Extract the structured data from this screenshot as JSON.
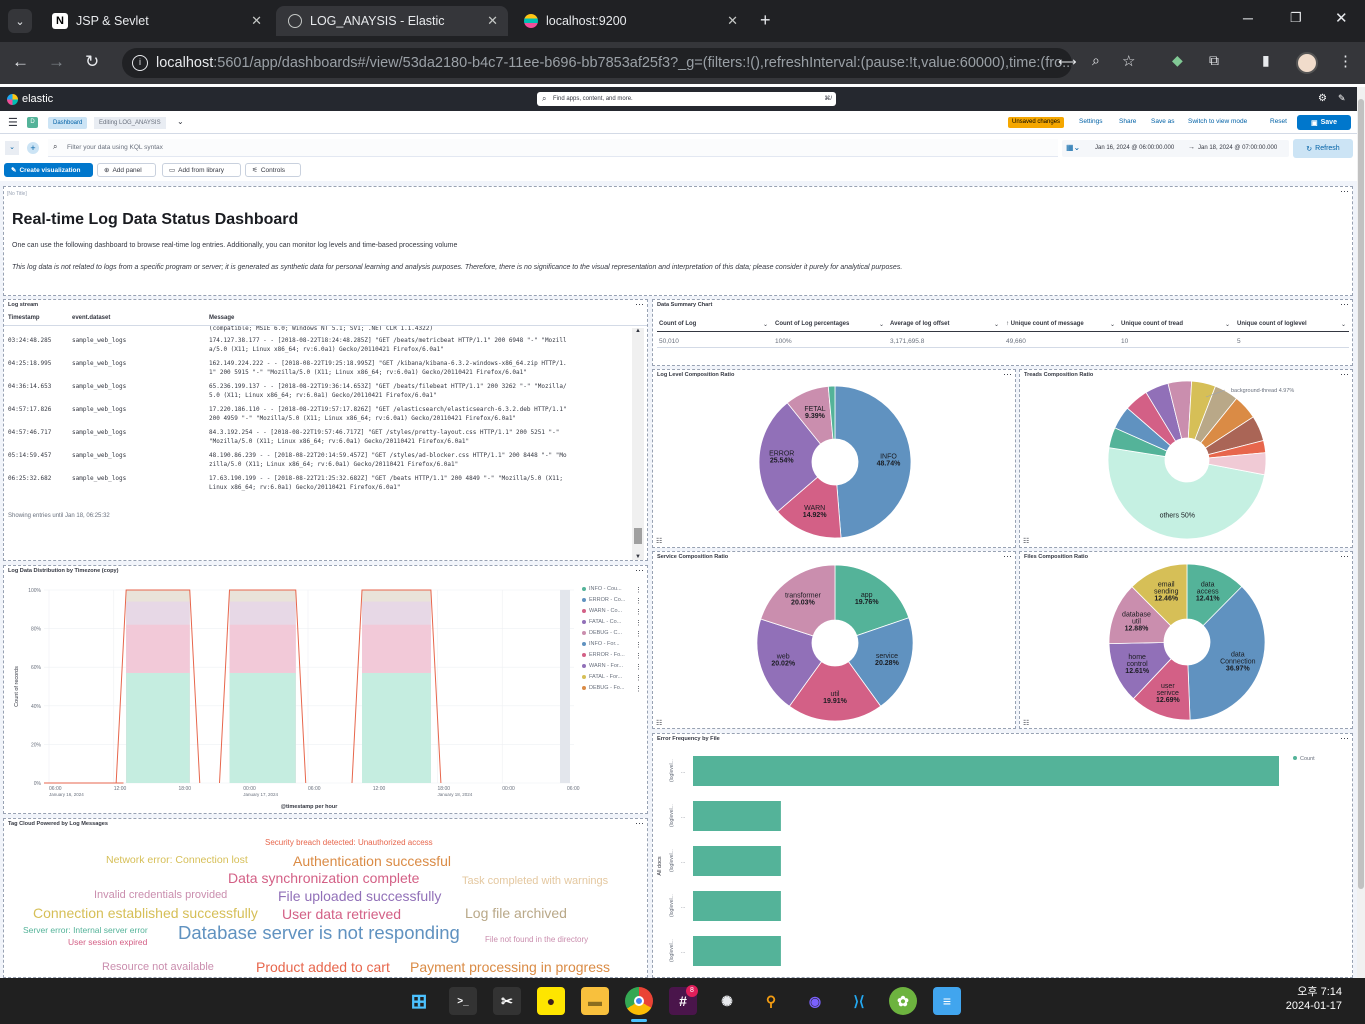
{
  "browser": {
    "tabs": [
      {
        "label": "JSP & Sevlet",
        "icon": "N"
      },
      {
        "label": "LOG_ANAYSIS - Elastic",
        "icon": "elastic"
      },
      {
        "label": "localhost:9200",
        "icon": "elastic"
      }
    ],
    "url_host": "localhost",
    "url_rest": ":5601/app/dashboards#/view/53da2180-b4c7-11ee-b696-bb7853af25f3?_g=(filters:!(),refreshInterval:(pause:!t,value:60000),time:(fro..."
  },
  "kibana": {
    "brand": "elastic",
    "search_placeholder": "Find apps, content, and more.",
    "search_shortcut": "⌘/",
    "space": "D",
    "breadcrumbs": [
      "Dashboard",
      "Editing LOG_ANAYSIS"
    ],
    "unsaved": "Unsaved changes",
    "top_actions": [
      "Settings",
      "Share",
      "Save as",
      "Switch to view mode",
      "Reset"
    ],
    "save": "Save",
    "kql_placeholder": "Filter your data using KQL syntax",
    "time_start": "Jan 16, 2024 @ 06:00:00.000",
    "time_arrow": "→",
    "time_end": "Jan 18, 2024 @ 07:00:00.000",
    "refresh": "Refresh",
    "toolbar": [
      "Create visualization",
      "Add panel",
      "Add from library",
      "Controls"
    ]
  },
  "markdown": {
    "tag": "[No Title]",
    "heading": "Real-time Log Data Status Dashboard",
    "p1": "One can use the following dashboard to browse real-time log entries. Additionally, you can monitor log levels and time-based processing volume",
    "p2": "This log data is not related to logs from a specific program or server; it is generated as synthetic data for personal learning and analysis purposes. Therefore, there is no significance to the visual representation and interpretation of this data; please consider it purely for analytical purposes."
  },
  "logstream": {
    "title": "Log stream",
    "cols": [
      "Timestamp",
      "event.dataset",
      "Message"
    ],
    "top_partial": "(compatible; MSIE 6.0; Windows NT 5.1; SV1; .NET CLR 1.1.4322)",
    "rows": [
      {
        "ts": "03:24:48.285",
        "ds": "sample_web_logs",
        "m1": "174.127.38.177 - - [2018-08-22T18:24:48.285Z] \"GET /beats/metricbeat HTTP/1.1\" 200 6948 \"-\" \"Mozill",
        "m2": "a/5.0 (X11; Linux x86_64; rv:6.0a1) Gecko/20110421 Firefox/6.0a1\""
      },
      {
        "ts": "04:25:18.995",
        "ds": "sample_web_logs",
        "m1": "162.149.224.222 - - [2018-08-22T19:25:18.995Z] \"GET /kibana/kibana-6.3.2-windows-x86_64.zip HTTP/1.",
        "m2": "1\" 200 5915 \"-\" \"Mozilla/5.0 (X11; Linux x86_64; rv:6.0a1) Gecko/20110421 Firefox/6.0a1\""
      },
      {
        "ts": "04:36:14.653",
        "ds": "sample_web_logs",
        "m1": "65.236.199.137 - - [2018-08-22T19:36:14.653Z] \"GET /beats/filebeat HTTP/1.1\" 200 3262 \"-\" \"Mozilla/",
        "m2": "5.0 (X11; Linux x86_64; rv:6.0a1) Gecko/20110421 Firefox/6.0a1\""
      },
      {
        "ts": "04:57:17.826",
        "ds": "sample_web_logs",
        "m1": "17.220.186.110 - - [2018-08-22T19:57:17.826Z] \"GET /elasticsearch/elasticsearch-6.3.2.deb HTTP/1.1\"",
        "m2": "200 4959 \"-\" \"Mozilla/5.0 (X11; Linux x86_64; rv:6.0a1) Gecko/20110421 Firefox/6.0a1\""
      },
      {
        "ts": "04:57:46.717",
        "ds": "sample_web_logs",
        "m1": "84.3.192.254 - - [2018-08-22T19:57:46.717Z] \"GET /styles/pretty-layout.css HTTP/1.1\" 200 5251 \"-\"",
        "m2": "\"Mozilla/5.0 (X11; Linux x86_64; rv:6.0a1) Gecko/20110421 Firefox/6.0a1\""
      },
      {
        "ts": "05:14:59.457",
        "ds": "sample_web_logs",
        "m1": "48.190.86.239 - - [2018-08-22T20:14:59.457Z] \"GET /styles/ad-blocker.css HTTP/1.1\" 200 8448 \"-\" \"Mo",
        "m2": "zilla/5.0 (X11; Linux x86_64; rv:6.0a1) Gecko/20110421 Firefox/6.0a1\""
      },
      {
        "ts": "06:25:32.682",
        "ds": "sample_web_logs",
        "m1": "17.63.190.199 - - [2018-08-22T21:25:32.682Z] \"GET /beats HTTP/1.1\" 200 4849 \"-\" \"Mozilla/5.0 (X11;",
        "m2": "Linux x86_64; rv:6.0a1) Gecko/20110421 Firefox/6.0a1\""
      }
    ],
    "footer": "Showing entries until Jan 18, 06:25:32"
  },
  "summary": {
    "title": "Data Summary Chart",
    "cols": [
      "Count of Log",
      "Count of Log percentages",
      "Average of log offset",
      "↑ Unique count of message",
      "Unique count of tread",
      "Unique count of loglevel"
    ],
    "row": [
      "50,010",
      "100%",
      "3,171,695.8",
      "49,660",
      "10",
      "5"
    ]
  },
  "chart_data": [
    {
      "type": "pie",
      "title": "Log Level Composition Ratio",
      "slices": [
        {
          "label": "INFO",
          "value": 48.74,
          "color": "#6092c0"
        },
        {
          "label": "WARN",
          "value": 14.92,
          "color": "#d36086"
        },
        {
          "label": "ERROR",
          "value": 25.54,
          "color": "#9170b8"
        },
        {
          "label": "FETAL",
          "value": 9.39,
          "color": "#ca8eae"
        },
        {
          "label": "",
          "value": 1.41,
          "color": "#54b399"
        }
      ]
    },
    {
      "type": "pie",
      "title": "Treads Composition Ratio",
      "slices": [
        {
          "label": "others",
          "value": 50,
          "color": "#c5f0e2"
        },
        {
          "label": "",
          "value": 4.21,
          "color": "#54b399"
        },
        {
          "label": "",
          "value": 4.77,
          "color": "#6092c0"
        },
        {
          "label": "",
          "value": 4.98,
          "color": "#d36086"
        },
        {
          "label": "",
          "value": 4.85,
          "color": "#9170b8"
        },
        {
          "label": "",
          "value": 4.86,
          "color": "#ca8eae"
        },
        {
          "label": "",
          "value": 4.97,
          "color": "#d6bf57"
        },
        {
          "label": "",
          "value": 4.97,
          "color": "#b9a888"
        },
        {
          "label": "",
          "value": 5.1,
          "color": "#da8b45"
        },
        {
          "label": "",
          "value": 5.26,
          "color": "#aa6556"
        },
        {
          "label": "",
          "value": 2.5,
          "color": "#e7664c"
        },
        {
          "label": "",
          "value": 4.53,
          "color": "#f0cad5"
        }
      ],
      "callout": "background-thread 4.97%"
    },
    {
      "type": "pie",
      "title": "Service Composition Ratio",
      "slices": [
        {
          "label": "app",
          "value": 19.76,
          "color": "#54b399"
        },
        {
          "label": "service",
          "value": 20.28,
          "color": "#6092c0"
        },
        {
          "label": "util",
          "value": 19.91,
          "color": "#d36086"
        },
        {
          "label": "web",
          "value": 20.02,
          "color": "#9170b8"
        },
        {
          "label": "transformer",
          "value": 20.03,
          "color": "#ca8eae"
        }
      ]
    },
    {
      "type": "pie",
      "title": "Files Composition Ratio",
      "slices": [
        {
          "label": "data access",
          "value": 12.41,
          "color": "#54b399"
        },
        {
          "label": "data Connection",
          "value": 36.97,
          "color": "#6092c0"
        },
        {
          "label": "user serivce",
          "value": 12.69,
          "color": "#d36086"
        },
        {
          "label": "home control",
          "value": 12.61,
          "color": "#9170b8"
        },
        {
          "label": "database util",
          "value": 12.88,
          "color": "#ca8eae"
        },
        {
          "label": "email sending",
          "value": 12.46,
          "color": "#d6bf57"
        }
      ]
    },
    {
      "type": "area",
      "title": "Log Data Distribution by Timezone (copy)",
      "ylabel": "Count of records",
      "xlabel": "@timestamp per hour",
      "yticks": [
        "100%",
        "80%",
        "60%",
        "40%",
        "20%",
        "0%"
      ],
      "xticks": [
        "06:00",
        "12:00",
        "18:00",
        "00:00",
        "06:00",
        "12:00",
        "18:00",
        "00:00",
        "06:00"
      ],
      "xsub": [
        "January 16, 2024",
        "January 17, 2024",
        "January 18, 2024"
      ],
      "series": [
        {
          "name": "INFO - Cou...",
          "color": "#54b399"
        },
        {
          "name": "ERROR - Co...",
          "color": "#6092c0"
        },
        {
          "name": "WARN - Co...",
          "color": "#d36086"
        },
        {
          "name": "FATAL - Co...",
          "color": "#9170b8"
        },
        {
          "name": "DEBUG - C...",
          "color": "#ca8eae"
        },
        {
          "name": "INFO - For...",
          "color": "#6092c0"
        },
        {
          "name": "ERROR - Fo...",
          "color": "#d36086"
        },
        {
          "name": "WARN - For...",
          "color": "#9170b8"
        },
        {
          "name": "FATAL - For...",
          "color": "#d6bf57"
        },
        {
          "name": "DEBUG - Fo...",
          "color": "#da8b45"
        }
      ]
    },
    {
      "type": "bar",
      "title": "Error Frequency by File",
      "ylabel": "All docs",
      "legend": "Count",
      "categories": [
        "(loglevel...",
        "(loglevel...",
        "(loglevel...",
        "(loglevel...",
        "(loglevel..."
      ],
      "values": [
        100,
        15,
        15,
        15,
        15
      ]
    }
  ],
  "tagcloud": {
    "title": "Tag Cloud Powered by Log Messages",
    "words": [
      "Security breach detected: Unauthorized access",
      "Network error: Connection lost",
      "Authentication successful",
      "Data synchronization complete",
      "Task completed with warnings",
      "Invalid credentials provided",
      "File uploaded successfully",
      "Connection established successfully",
      "User data retrieved",
      "Log file archived",
      "Server error: Internal server error",
      "Database server is not responding",
      "File not found in the directory",
      "User session expired",
      "Resource not available",
      "Product added to cart",
      "Payment processing in progress"
    ]
  },
  "taskbar": {
    "time": "오후 7:14",
    "date": "2024-01-17",
    "badge": "8"
  }
}
